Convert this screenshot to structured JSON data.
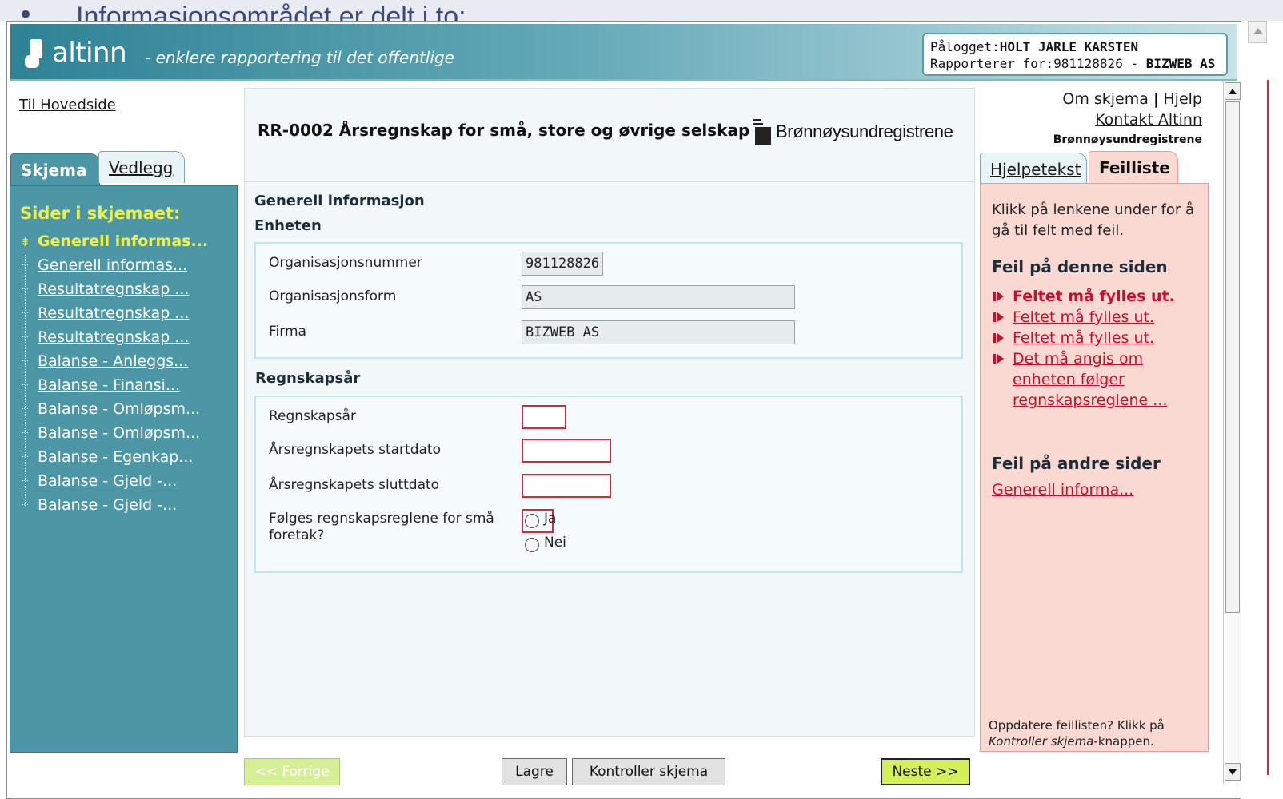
{
  "slide": {
    "bullet": "•",
    "text": "Informasjonsområdet er delt i to:"
  },
  "header": {
    "logo_text": "altinn",
    "tagline": "- enklere rapportering til det offentlige",
    "logged_in_label": "Pålogget:",
    "logged_in_name": "HOLT JARLE KARSTEN",
    "reporting_for_label": "Rapporterer for:",
    "reporting_for_org": "981128826 - ",
    "reporting_for_name": "BIZWEB AS"
  },
  "left": {
    "home_link": "Til Hovedside",
    "tabs": [
      {
        "label": "Skjema",
        "active": true
      },
      {
        "label": "Vedlegg",
        "active": false
      }
    ],
    "pages_title": "Sider i skjemaet:",
    "pages": [
      {
        "label": "Generell informas...",
        "active": true
      },
      {
        "label": "Generell informas...",
        "active": false
      },
      {
        "label": "Resultatregnskap ...",
        "active": false
      },
      {
        "label": "Resultatregnskap ...",
        "active": false
      },
      {
        "label": "Resultatregnskap ...",
        "active": false
      },
      {
        "label": "Balanse - Anleggs...",
        "active": false
      },
      {
        "label": "Balanse - Finansi...",
        "active": false
      },
      {
        "label": "Balanse - Omløpsm...",
        "active": false
      },
      {
        "label": "Balanse - Omløpsm...",
        "active": false
      },
      {
        "label": "Balanse - Egenkap...",
        "active": false
      },
      {
        "label": "Balanse - Gjeld -...",
        "active": false
      },
      {
        "label": "Balanse - Gjeld -...",
        "active": false
      }
    ]
  },
  "form": {
    "title": "RR-0002 Årsregnskap for små, store og øvrige selskap",
    "brreg_logo": "Brønnøysundregistrene",
    "section_general": "Generell informasjon",
    "section_entity": "Enheten",
    "org_number_label": "Organisasjonsnummer",
    "org_number_value": "981128826",
    "org_form_label": "Organisasjonsform",
    "org_form_value": "AS",
    "company_label": "Firma",
    "company_value": "BIZWEB AS",
    "section_year": "Regnskapsår",
    "year_label": "Regnskapsår",
    "year_value": "",
    "start_label": "Årsregnskapets startdato",
    "start_value": "",
    "end_label": "Årsregnskapets sluttdato",
    "end_value": "",
    "small_rules_label": "Følges regnskapsreglene for små foretak?",
    "option_yes": "Ja",
    "option_no": "Nei"
  },
  "buttons": {
    "previous": "<< Forrige",
    "save": "Lagre",
    "check": "Kontroller skjema",
    "next": "Neste >>"
  },
  "right": {
    "link_about": "Om skjema",
    "separator": "|",
    "link_help": "Hjelp",
    "link_contact": "Kontakt Altinn",
    "agency": "Brønnøysundregistrene",
    "tabs": [
      {
        "label": "Hjelpetekst",
        "active": false
      },
      {
        "label": "Feilliste",
        "active": true
      }
    ],
    "intro": "Klikk på lenkene under for å gå til felt med feil.",
    "errors_this_page_title": "Feil på denne siden",
    "errors": [
      {
        "label": "Feltet må fylles ut.",
        "active": true
      },
      {
        "label": "Feltet må fylles ut.",
        "active": false
      },
      {
        "label": "Feltet må fylles ut.",
        "active": false
      },
      {
        "label": "Det må angis om enheten følger regnskapsreglene ...",
        "active": false
      }
    ],
    "errors_other_title": "Feil på andre sider",
    "errors_other_link": "Generell informa...",
    "footer_prefix": "Oppdatere feillisten? Klikk på ",
    "footer_italic": "Kontroller skjema",
    "footer_suffix": "-knappen."
  },
  "colors": {
    "accent_teal": "#4d96a5",
    "active_yellow": "#eef04a",
    "error_red": "#c8102e",
    "error_panel": "#fad9d3",
    "next_button": "#d3f05a"
  }
}
